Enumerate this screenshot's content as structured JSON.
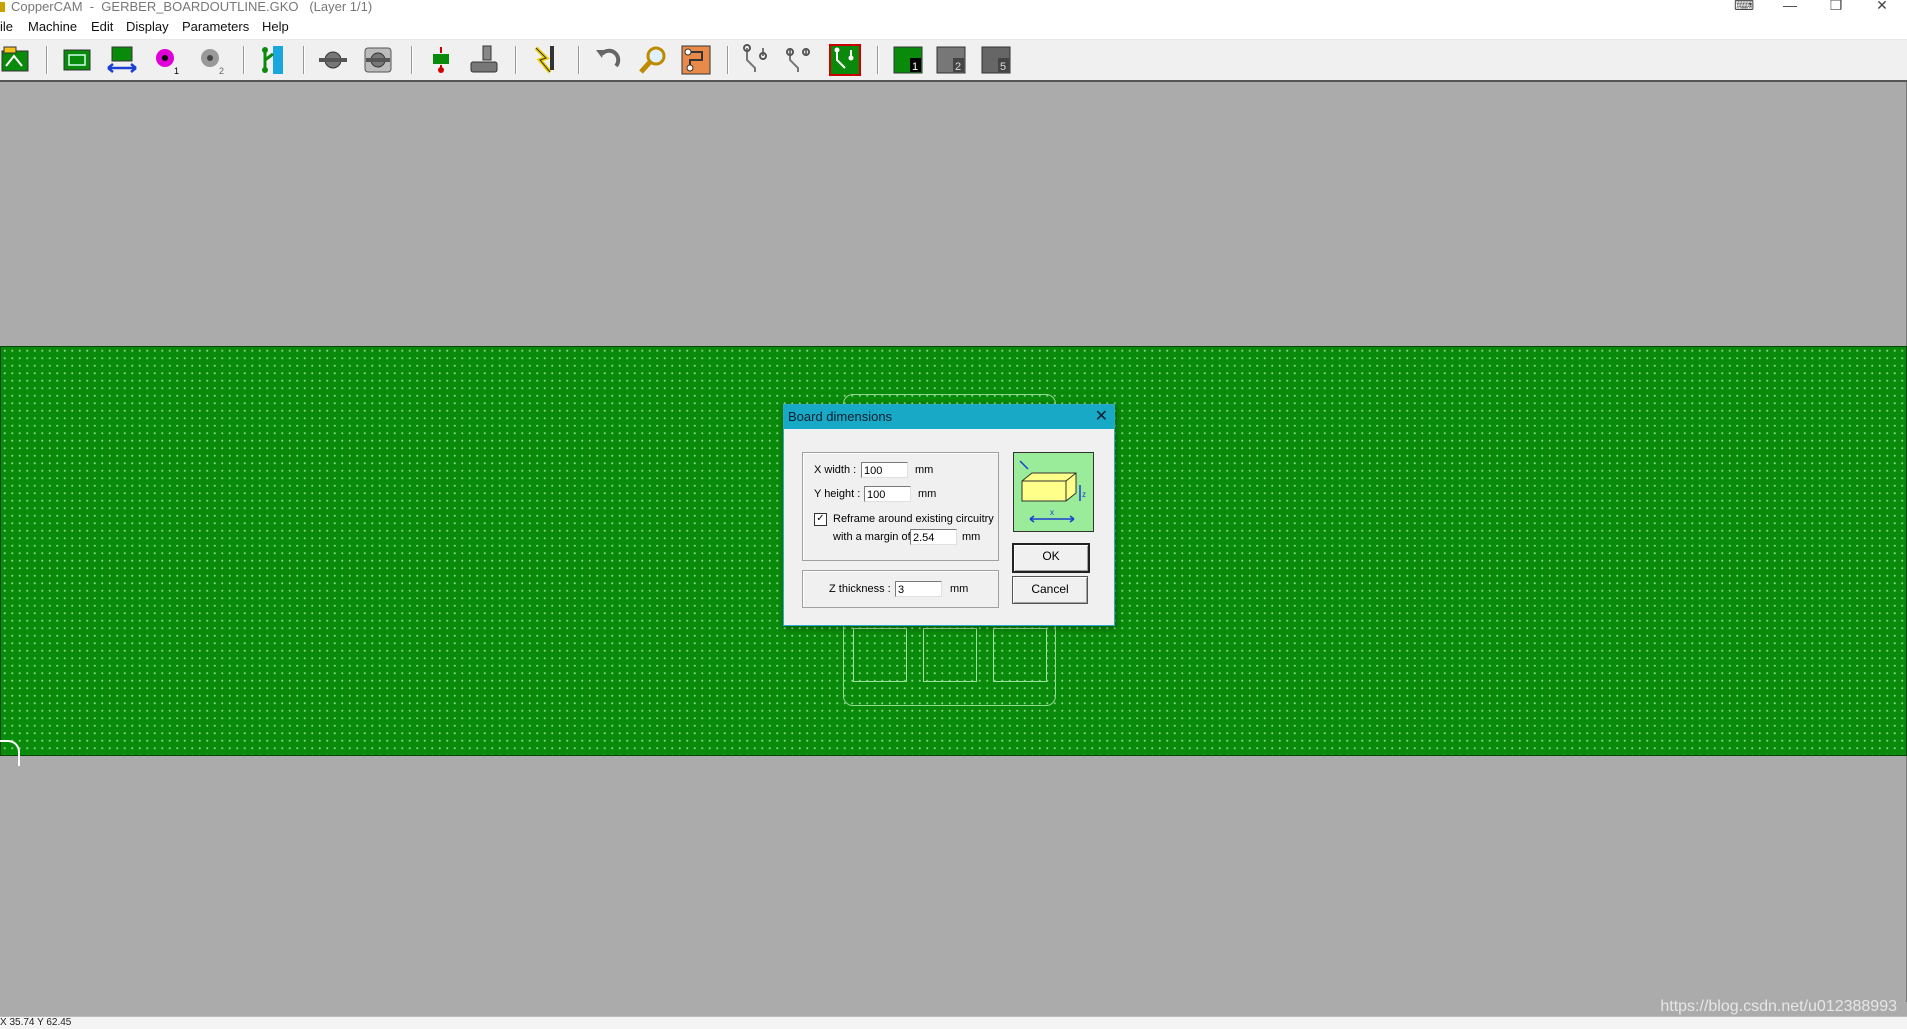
{
  "window": {
    "title": "CopperCAM  -  GERBER_BOARDOUTLINE.GKO   (Layer 1/1)",
    "controls": {
      "keyboard": "⌨",
      "minimize": "—",
      "restore": "❐",
      "close": "✕"
    }
  },
  "menu": [
    "ile",
    "Machine",
    "Edit",
    "Display",
    "Parameters",
    "Help"
  ],
  "toolbar_icons": [
    "open-file-icon",
    "board-outline-icon",
    "board-dimensions-icon",
    "pad-layer1-icon",
    "pad-layer2-icon",
    "track-icon",
    "tool-icon",
    "drill-tool-icon",
    "contour-icon",
    "milling-icon",
    "engrave-icon",
    "undo-icon",
    "zoom-icon",
    "tracks-view-icon",
    "route1-icon",
    "route2-icon",
    "route3-icon",
    "layer1-icon",
    "layer2-icon",
    "layer5-icon"
  ],
  "colors": {
    "board": "#0a8a0a",
    "dialog_title": "#17a9c6",
    "canvas": "#ababab"
  },
  "dialog": {
    "title": "Board dimensions",
    "x_width_label": "X width :",
    "x_width_value": "100",
    "x_unit": "mm",
    "y_height_label": "Y height :",
    "y_height_value": "100",
    "y_unit": "mm",
    "reframe_checked": true,
    "reframe_label": "Reframe around existing circuitry",
    "margin_label": "with a margin of",
    "margin_value": "2.54",
    "margin_unit": "mm",
    "z_label": "Z thickness :",
    "z_value": "3",
    "z_unit": "mm",
    "ok_label": "OK",
    "cancel_label": "Cancel",
    "preview_axis_x": "x",
    "preview_axis_z": "z"
  },
  "status": {
    "coords": "X 35.74   Y 62.45"
  },
  "watermark": "https://blog.csdn.net/u012388993"
}
